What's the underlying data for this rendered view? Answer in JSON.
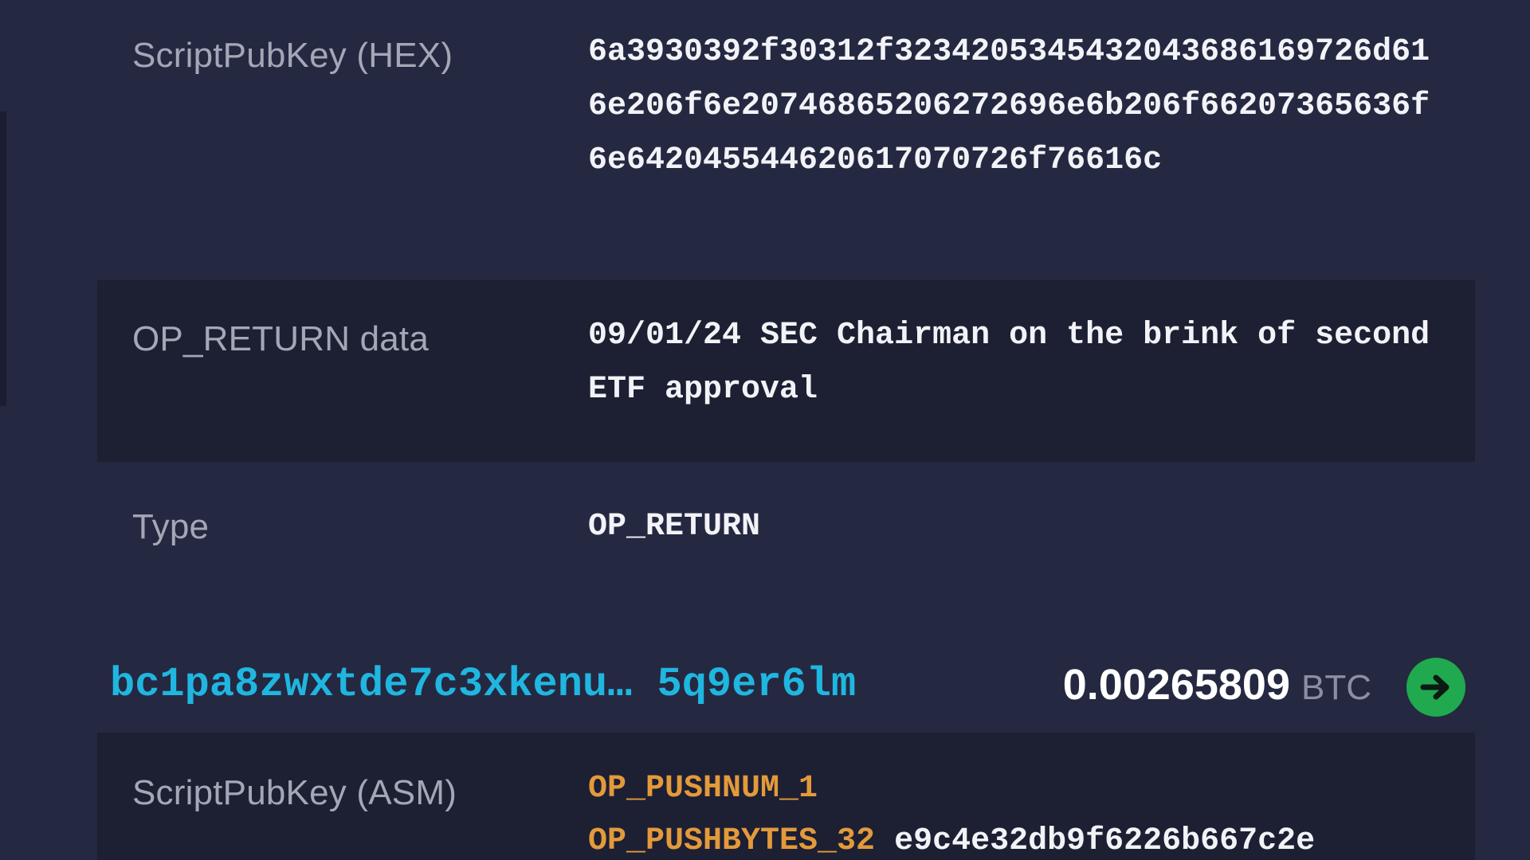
{
  "rows": {
    "hex": {
      "label": "ScriptPubKey (HEX)",
      "value": "6a3930392f30312f3234205345432043686169726d616e206f6e20746865206272696e6b206f66207365636f6e642045544620617070726f76616c"
    },
    "op_return": {
      "label": "OP_RETURN data",
      "value": "09/01/24 SEC Chairman on the brink of second ETF approval"
    },
    "type": {
      "label": "Type",
      "value": "OP_RETURN"
    }
  },
  "output": {
    "address": "bc1pa8zwxtde7c3xkenu… 5q9er6lm",
    "amount": "0.00265809",
    "unit": "BTC",
    "go_icon": "arrow-right-icon",
    "go_color": "#20a94f",
    "address_color": "#1fb6e0"
  },
  "asm": {
    "label": "ScriptPubKey (ASM)",
    "line1_opcode": "OP_PUSHNUM_1",
    "line2_opcode": "OP_PUSHBYTES_32",
    "line2_data": "e9c4e32db9f6226b667c2e"
  },
  "colors": {
    "background": "#252841",
    "row_dark": "#1d1f33",
    "opcode": "#e39a3b"
  }
}
